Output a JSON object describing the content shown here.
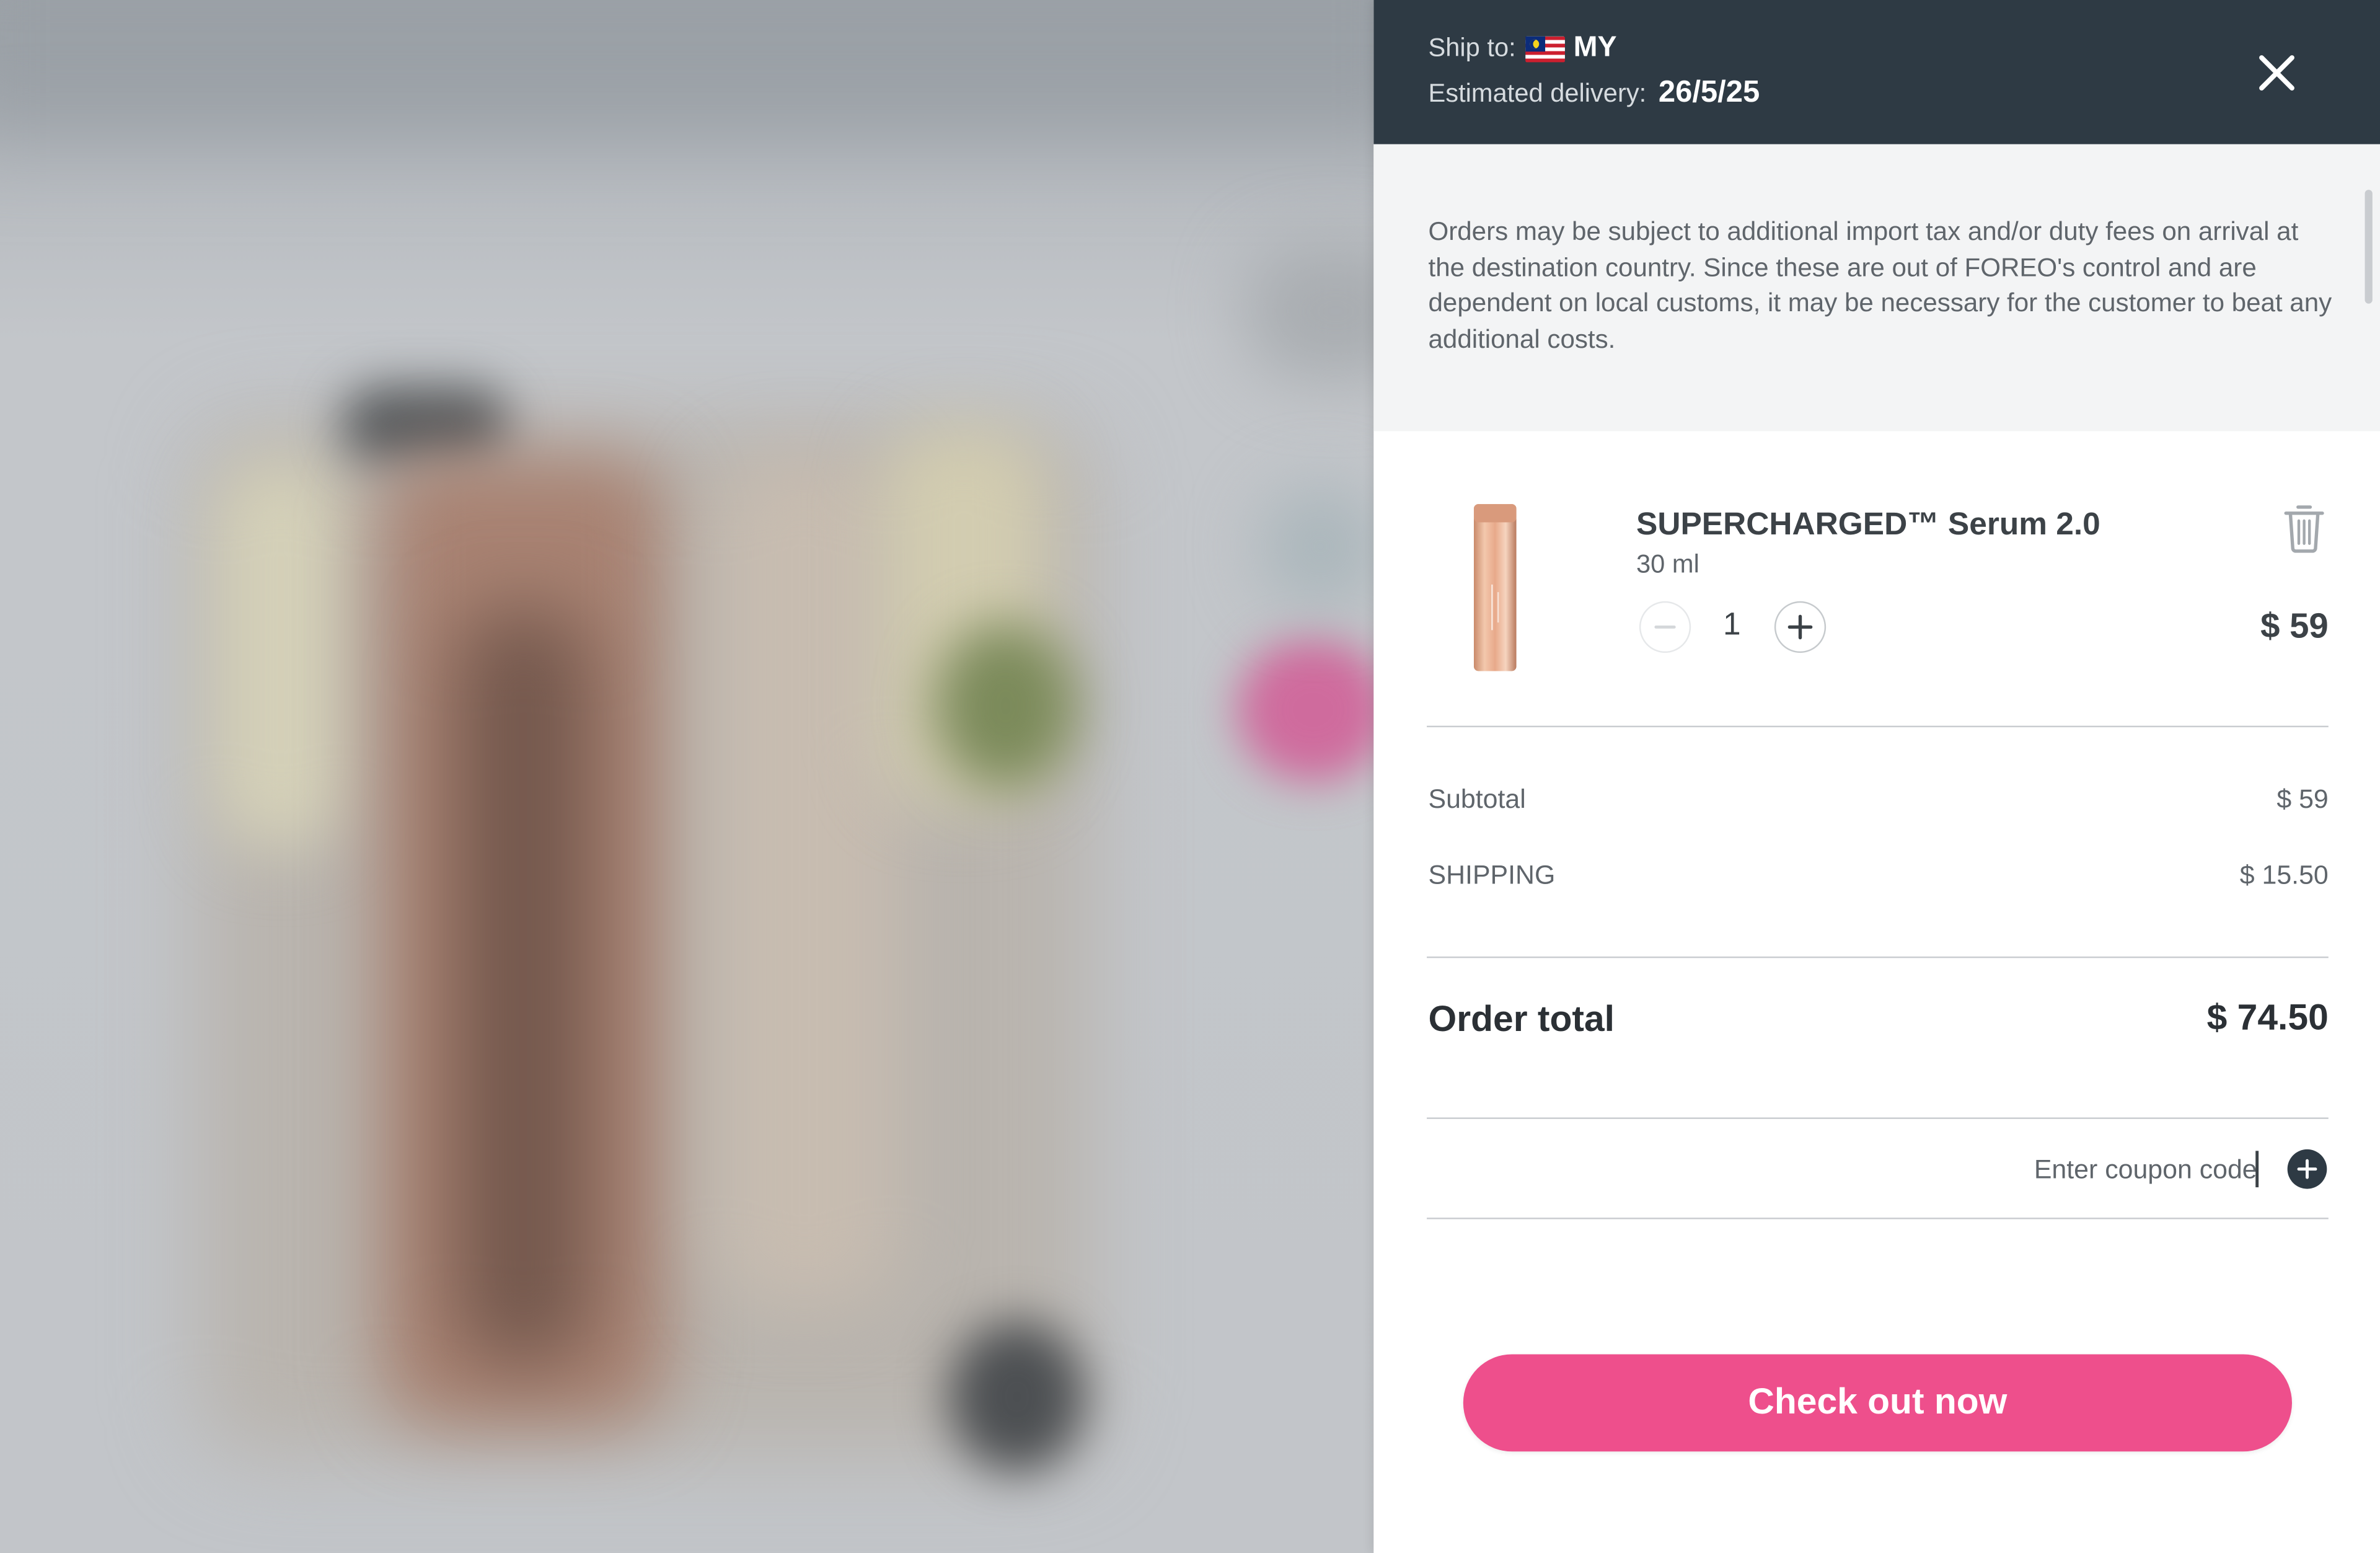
{
  "header": {
    "ship_to_label": "Ship to:",
    "country_code": "MY",
    "country_flag": "malaysia-flag",
    "delivery_label": "Estimated delivery:",
    "delivery_date": "26/5/25",
    "background_color": "#2e3a44"
  },
  "notice": {
    "text": "Orders may be subject to additional import tax and/or duty fees on arrival at the destination country. Since these are out of FOREO's control and are dependent on local customs, it may be necessary for the customer to beat any additional costs."
  },
  "cart_item": {
    "name": "SUPERCHARGED™ Serum 2.0",
    "size": "30 ml",
    "quantity": "1",
    "price": "$ 59"
  },
  "summary": {
    "subtotal_label": "Subtotal",
    "subtotal_value": "$ 59",
    "shipping_label": "SHIPPING",
    "shipping_value": "$ 15.50",
    "total_label": "Order total",
    "total_value": "$ 74.50"
  },
  "coupon": {
    "placeholder": "Enter coupon code"
  },
  "checkout": {
    "label": "Check out now",
    "color": "#ee4f8c"
  }
}
